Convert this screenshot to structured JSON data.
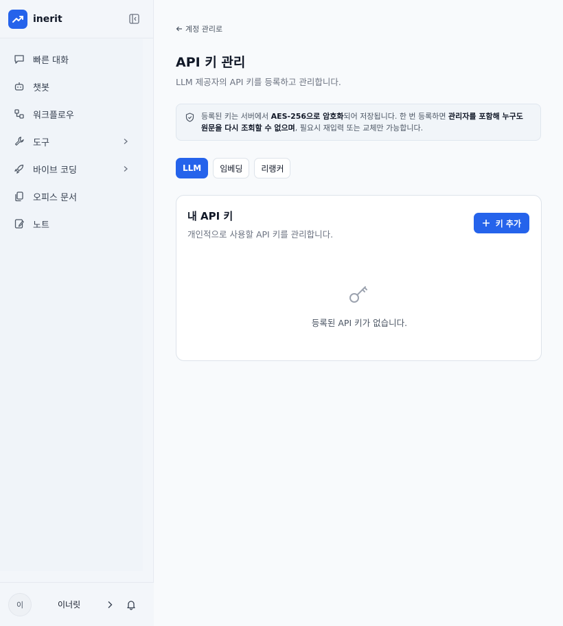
{
  "app": {
    "name": "inerit",
    "brand_color": "#2563eb"
  },
  "sidebar": {
    "items": [
      {
        "label": "빠른 대화",
        "icon": "chat-icon",
        "has_submenu": false
      },
      {
        "label": "챗봇",
        "icon": "bot-icon",
        "has_submenu": false
      },
      {
        "label": "워크플로우",
        "icon": "workflow-icon",
        "has_submenu": false
      },
      {
        "label": "도구",
        "icon": "wrench-icon",
        "has_submenu": true
      },
      {
        "label": "바이브 코딩",
        "icon": "rocket-icon",
        "has_submenu": true
      },
      {
        "label": "오피스 문서",
        "icon": "documents-icon",
        "has_submenu": false
      },
      {
        "label": "노트",
        "icon": "notebook-icon",
        "has_submenu": false
      }
    ]
  },
  "user": {
    "avatar_text": "이",
    "name": "이너릿"
  },
  "page": {
    "back_label": "계정 관리로",
    "title": "API 키 관리",
    "subtitle": "LLM 제공자의 API 키를 등록하고 관리합니다."
  },
  "notice": {
    "part1": "등록된 키는 서버에서 ",
    "bold1": "AES-256으로 암호화",
    "part2": "되어 저장됩니다. 한 번 등록하면 ",
    "bold2": "관리자를 포함해 누구도 원문을 다시 조회할 수 없으며",
    "part3": ", 필요시 재입력 또는 교체만 가능합니다."
  },
  "tabs": [
    {
      "label": "LLM",
      "active": true
    },
    {
      "label": "임베딩",
      "active": false
    },
    {
      "label": "리랭커",
      "active": false
    }
  ],
  "card": {
    "title": "내 API 키",
    "description": "개인적으로 사용할 API 키를 관리합니다.",
    "add_button": "키 추가",
    "empty_text": "등록된 API 키가 없습니다."
  }
}
